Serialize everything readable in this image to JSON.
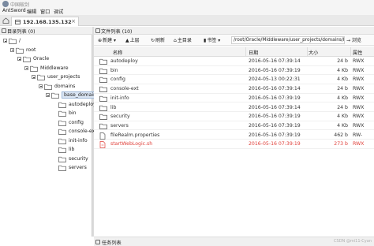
{
  "window": {
    "title": "中国蚁剑"
  },
  "menu": [
    "AntSword",
    "编辑",
    "窗口",
    "调试"
  ],
  "tab": {
    "label": "192.168.135.132",
    "close": "×"
  },
  "left_panel": {
    "title": "目录列表 (0)"
  },
  "right_panel": {
    "title": "文件列表 (10)"
  },
  "tree": [
    {
      "label": "/",
      "depth": 0
    },
    {
      "label": "root",
      "depth": 1
    },
    {
      "label": "Oracle",
      "depth": 2
    },
    {
      "label": "Middleware",
      "depth": 3
    },
    {
      "label": "user_projects",
      "depth": 4
    },
    {
      "label": "domains",
      "depth": 5
    },
    {
      "label": "base_domain",
      "depth": 6,
      "selected": true
    },
    {
      "label": "autodeploy",
      "depth": 7
    },
    {
      "label": "bin",
      "depth": 7
    },
    {
      "label": "config",
      "depth": 7
    },
    {
      "label": "console-ext",
      "depth": 7
    },
    {
      "label": "init-info",
      "depth": 7
    },
    {
      "label": "lib",
      "depth": 7
    },
    {
      "label": "security",
      "depth": 7
    },
    {
      "label": "servers",
      "depth": 7
    }
  ],
  "toolbar": {
    "new": "新建",
    "up": "上层",
    "refresh": "刷新",
    "home": "主目录",
    "bookmark": "书签",
    "path": "/root/Oracle/Middleware/user_projects/domains/base_d",
    "go": "→ 浏览"
  },
  "columns": {
    "name": "名称",
    "date": "日期",
    "size": "大小",
    "attr": "属性"
  },
  "files": [
    {
      "name": "autodeploy",
      "date": "2016-05-16 07:39:14",
      "size": "24 b",
      "attr": "RWX",
      "type": "folder"
    },
    {
      "name": "bin",
      "date": "2016-05-16 07:39:19",
      "size": "4 Kb",
      "attr": "RWX",
      "type": "folder"
    },
    {
      "name": "config",
      "date": "2024-05-13 00:22:31",
      "size": "4 Kb",
      "attr": "RWX",
      "type": "folder"
    },
    {
      "name": "console-ext",
      "date": "2016-05-16 07:39:14",
      "size": "24 b",
      "attr": "RWX",
      "type": "folder"
    },
    {
      "name": "init-info",
      "date": "2016-05-16 07:39:19",
      "size": "4 Kb",
      "attr": "RWX",
      "type": "folder"
    },
    {
      "name": "lib",
      "date": "2016-05-16 07:39:14",
      "size": "24 b",
      "attr": "RWX",
      "type": "folder"
    },
    {
      "name": "security",
      "date": "2016-05-16 07:39:19",
      "size": "4 Kb",
      "attr": "RWX",
      "type": "folder"
    },
    {
      "name": "servers",
      "date": "2016-05-16 07:39:19",
      "size": "4 Kb",
      "attr": "RWX",
      "type": "folder"
    },
    {
      "name": "fileRealm.properties",
      "date": "2016-05-16 07:39:19",
      "size": "462 b",
      "attr": "RW-",
      "type": "file"
    },
    {
      "name": "startWebLogic.sh",
      "date": "2016-05-16 07:39:19",
      "size": "273 b",
      "attr": "RWX",
      "type": "script"
    }
  ],
  "bottom_panel": {
    "title": "任务列表"
  },
  "watermark": "CSDN @mi11-Cyan",
  "colors": {
    "folder": "#333333",
    "script_text": "#e0403a",
    "selection": "#dbe6f4"
  },
  "icons": {
    "folder": "folder-icon",
    "file": "file-icon",
    "script": "file-code-icon"
  }
}
